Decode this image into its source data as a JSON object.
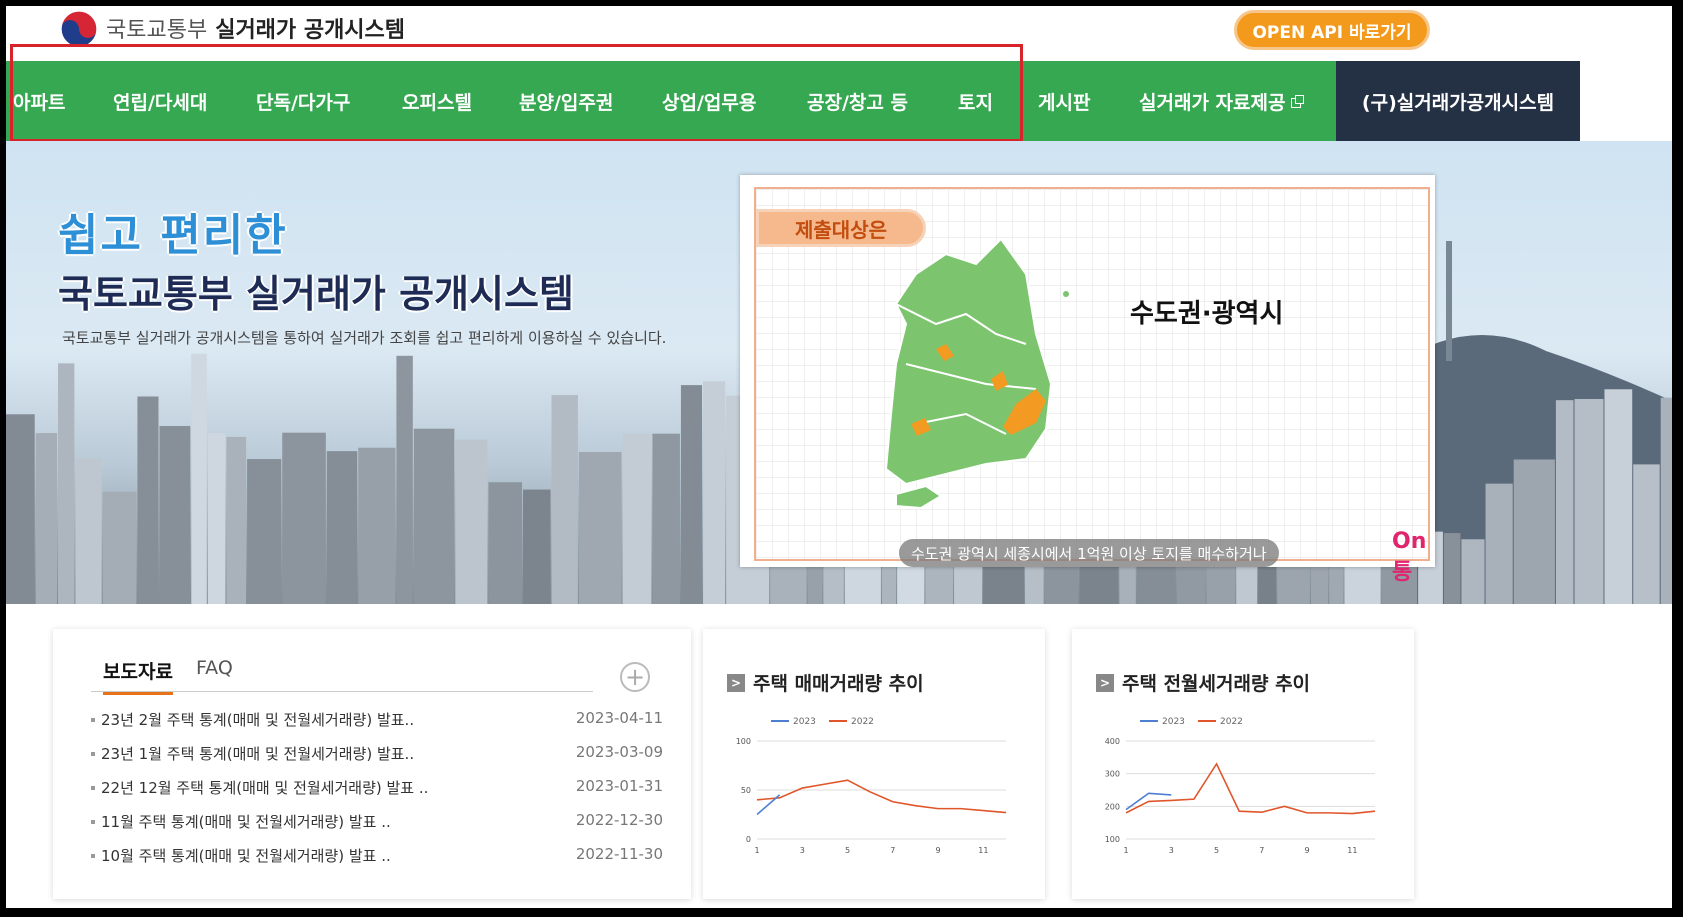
{
  "header": {
    "logo_ministry": "국토교통부",
    "logo_system": "실거래가 공개시스템",
    "open_api_button": "OPEN API 바로가기"
  },
  "nav": {
    "items": [
      "아파트",
      "연립/다세대",
      "단독/다가구",
      "오피스텔",
      "분양/입주권",
      "상업/업무용",
      "공장/창고 등",
      "토지",
      "게시판",
      "실거래가 자료제공"
    ],
    "old_system": "(구)실거래가공개시스템"
  },
  "hero": {
    "title_line1": "쉽고 편리한",
    "title_line2": "국토교통부 실거래가 공개시스템",
    "subtitle": "국토교통부 실거래가 공개시스템을 통하여 실거래가 조회를 쉽고 편리하게 이용하실 수 있습니다.",
    "video_tag": "제출대상은",
    "video_region": "수도권·광역시",
    "video_caption": "수도권 광역시 세종시에서 1억원 이상 토지를 매수하거나",
    "video_logo": "On통"
  },
  "news": {
    "tab_active": "보도자료",
    "tab_faq": "FAQ",
    "plus_label": "+",
    "items": [
      {
        "title": "23년 2월 주택 통계(매매 및 전월세거래량) 발표..",
        "date": "2023-04-11"
      },
      {
        "title": "23년 1월 주택 통계(매매 및 전월세거래량) 발표..",
        "date": "2023-03-09"
      },
      {
        "title": "22년 12월 주택 통계(매매 및 전월세거래량) 발표 ..",
        "date": "2023-01-31"
      },
      {
        "title": "11월 주택 통계(매매 및 전월세거래량) 발표 ..",
        "date": "2022-12-30"
      },
      {
        "title": "10월 주택 통계(매매 및 전월세거래량) 발표 ..",
        "date": "2022-11-30"
      }
    ]
  },
  "colors": {
    "nav_green": "#36a852",
    "old_system_bg": "#243043",
    "accent_orange": "#f39a1c",
    "series_2023": "#4f7fd0",
    "series_2022": "#e0562a"
  },
  "chart_data": [
    {
      "type": "line",
      "title": "주택 매매거래량 추이",
      "x": [
        1,
        2,
        3,
        4,
        5,
        6,
        7,
        8,
        9,
        10,
        11,
        12
      ],
      "xticks": [
        "1",
        "3",
        "5",
        "7",
        "9",
        "11"
      ],
      "yticks": [
        "0",
        "50",
        "100"
      ],
      "ylim": [
        0,
        100
      ],
      "series": [
        {
          "name": "2023",
          "values": [
            25,
            45
          ]
        },
        {
          "name": "2022",
          "values": [
            40,
            42,
            52,
            56,
            60,
            48,
            38,
            34,
            31,
            31,
            29,
            27
          ]
        }
      ]
    },
    {
      "type": "line",
      "title": "주택 전월세거래량 추이",
      "x": [
        1,
        2,
        3,
        4,
        5,
        6,
        7,
        8,
        9,
        10,
        11,
        12
      ],
      "xticks": [
        "1",
        "3",
        "5",
        "7",
        "9",
        "11"
      ],
      "yticks": [
        "100",
        "200",
        "300",
        "400"
      ],
      "ylim": [
        100,
        400
      ],
      "series": [
        {
          "name": "2023",
          "values": [
            190,
            240,
            235
          ]
        },
        {
          "name": "2022",
          "values": [
            180,
            215,
            218,
            222,
            330,
            185,
            182,
            200,
            180,
            180,
            178,
            185
          ]
        }
      ]
    }
  ]
}
